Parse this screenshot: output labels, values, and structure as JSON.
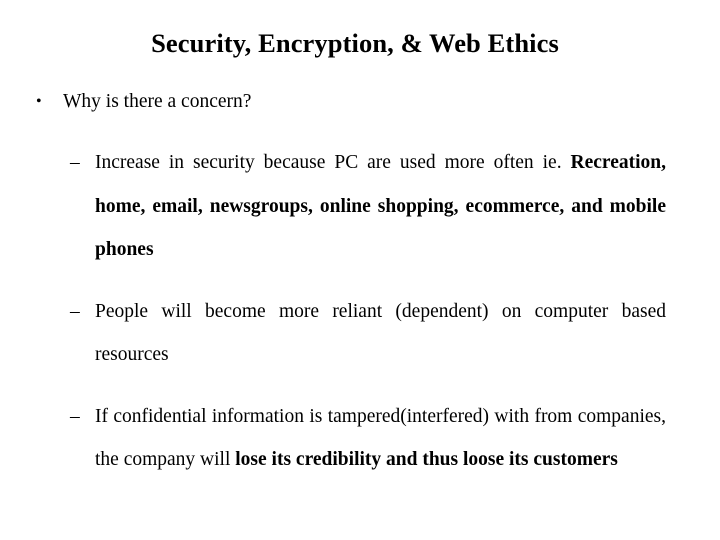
{
  "slide": {
    "title": "Security, Encryption, & Web Ethics",
    "bullets": [
      {
        "level": 1,
        "marker": "•",
        "text": "Why is there a concern?"
      },
      {
        "level": 2,
        "marker": "–",
        "text_regular": "Increase in security because PC are used more often  ie.",
        "text_bold": " Recreation, home, email, newsgroups, online shopping, ecommerce, and mobile phones"
      },
      {
        "level": 2,
        "marker": "–",
        "text_regular": "People will become more reliant (dependent) on computer based resources",
        "text_bold": ""
      },
      {
        "level": 2,
        "marker": "–",
        "text_regular": "If confidential information is tampered(interfered) with from companies, the company will ",
        "text_bold": "lose its credibility and thus loose its customers"
      }
    ]
  },
  "colors": {
    "background": "#ffffff",
    "text": "#000000"
  }
}
